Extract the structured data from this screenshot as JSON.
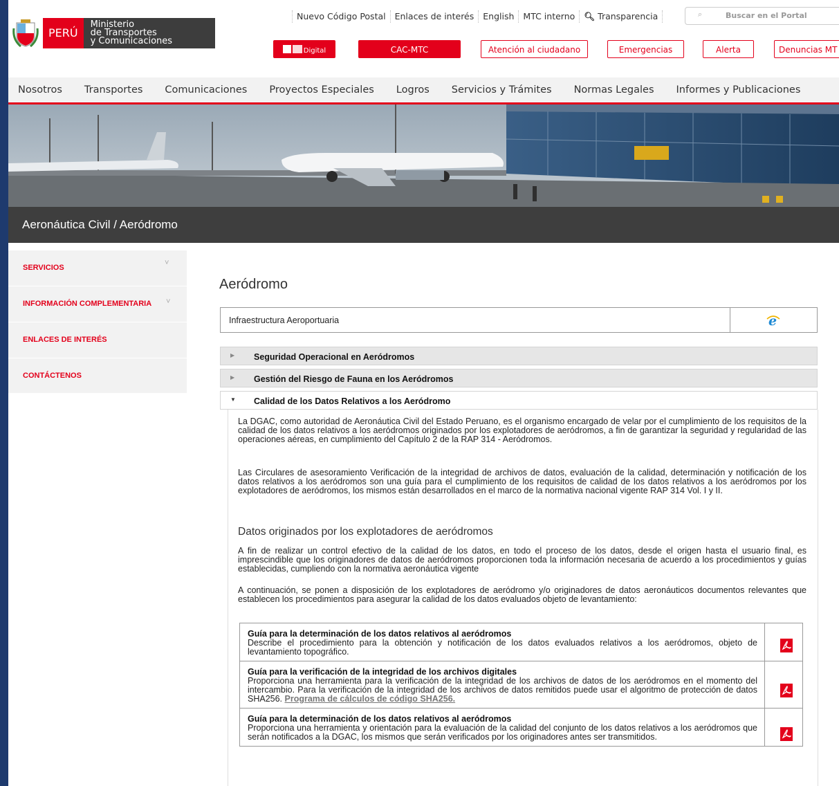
{
  "header": {
    "peru": "PERÚ",
    "ministry_lines": [
      "Ministerio",
      "de Transportes",
      "y Comunicaciones"
    ],
    "top_links": [
      "Nuevo Código Postal",
      "Enlaces de interés",
      "English",
      "MTC interno",
      "Transparencia"
    ],
    "search_placeholder": "Buscar en el Portal",
    "buttons": {
      "digital": "Digital",
      "cac": "CAC-MTC",
      "atencion": "Atención al ciudadano",
      "emergencias": "Emergencias",
      "alerta": "Alerta",
      "denuncias": "Denuncias MT"
    }
  },
  "nav": [
    "Nosotros",
    "Transportes",
    "Comunicaciones",
    "Proyectos Especiales",
    "Logros",
    "Servicios y Trámites",
    "Normas Legales",
    "Informes y Publicaciones"
  ],
  "section_title": "Aeronáutica Civil / Aeródromo",
  "sidebar": [
    "SERVICIOS",
    "INFORMACIÓN COMPLEMENTARIA",
    "ENLACES DE INTERÉS",
    "CONTÁCTENOS"
  ],
  "main": {
    "title": "Aeródromo",
    "infra_label": "Infraestructura Aeroportuaria",
    "accordion": [
      "Seguridad Operacional en Aeródromos",
      "Gestión del Riesgo de Fauna en los Aeródromos",
      "Calidad de los Datos Relativos a los Aeródromo"
    ],
    "p1": "La DGAC, como autoridad de Aeronáutica Civil del Estado Peruano, es el organismo encargado de velar por el cumplimiento de los requisitos de la calidad de los datos relativos a los aeródromos originados por los explotadores de aeródromos, a fin de garantizar la seguridad y regularidad de las operaciones aéreas, en cumplimiento del Capítulo 2 de la RAP 314 - Aeródromos.",
    "p2": "Las Circulares de asesoramiento Verificación de la integridad de archivos de datos, evaluación de la calidad, determinación y notificación de los datos relativos a los aeródromos son una guía para el cumplimiento de los requisitos de calidad de los datos relativos a los aeródromos por los explotadores de aeródromos, los mismos están desarrollados en el marco de la normativa nacional vigente RAP 314 Vol. I y II.",
    "subheading": "Datos originados por los explotadores de aeródromos",
    "p3": "A fin de realizar un control efectivo de la calidad de los datos, en todo el proceso de los datos, desde el origen hasta el usuario final, es imprescindible que los originadores de datos de aeródromos proporcionen toda la información necesaria de acuerdo a los procedimientos y guías establecidas, cumpliendo con la normativa aeronáutica vigente",
    "p4": "A continuación, se ponen a disposición de los explotadores de aeródromo y/o originadores de datos aeronáuticos documentos relevantes que establecen los procedimientos para asegurar la calidad de los datos evaluados objeto de levantamiento:",
    "docs": [
      {
        "title": "Guía para la determinación de los datos relativos al aeródromos",
        "desc": "Describe el procedimiento para la obtención y notificación de los datos evaluados relativos a los aeródromos, objeto de levantamiento topográfico."
      },
      {
        "title": "Guía para la verificación de la integridad de los archivos digitales",
        "desc": "Proporciona una herramienta para la verificación de la integridad de los archivos de datos de los aeródromos en el momento del intercambio. Para la verificación de la integridad de los archivos de datos remitidos puede usar el algoritmo de protección de datos SHA256. ",
        "link": "Programa de cálculos de código SHA256."
      },
      {
        "title": "Guía para la determinación de los datos relativos al aeródromos",
        "desc": "Proporciona una herramienta y orientación para la evaluación de la calidad del conjunto de los datos relativos a los aeródromos que serán notificados a la DGAC, los mismos que serán verificados por los originadores antes ser transmitidos."
      }
    ]
  },
  "colors": {
    "brand_red": "#e3001b",
    "frame_blue": "#1e3a6e",
    "dark_bar": "#3e3e3e"
  }
}
